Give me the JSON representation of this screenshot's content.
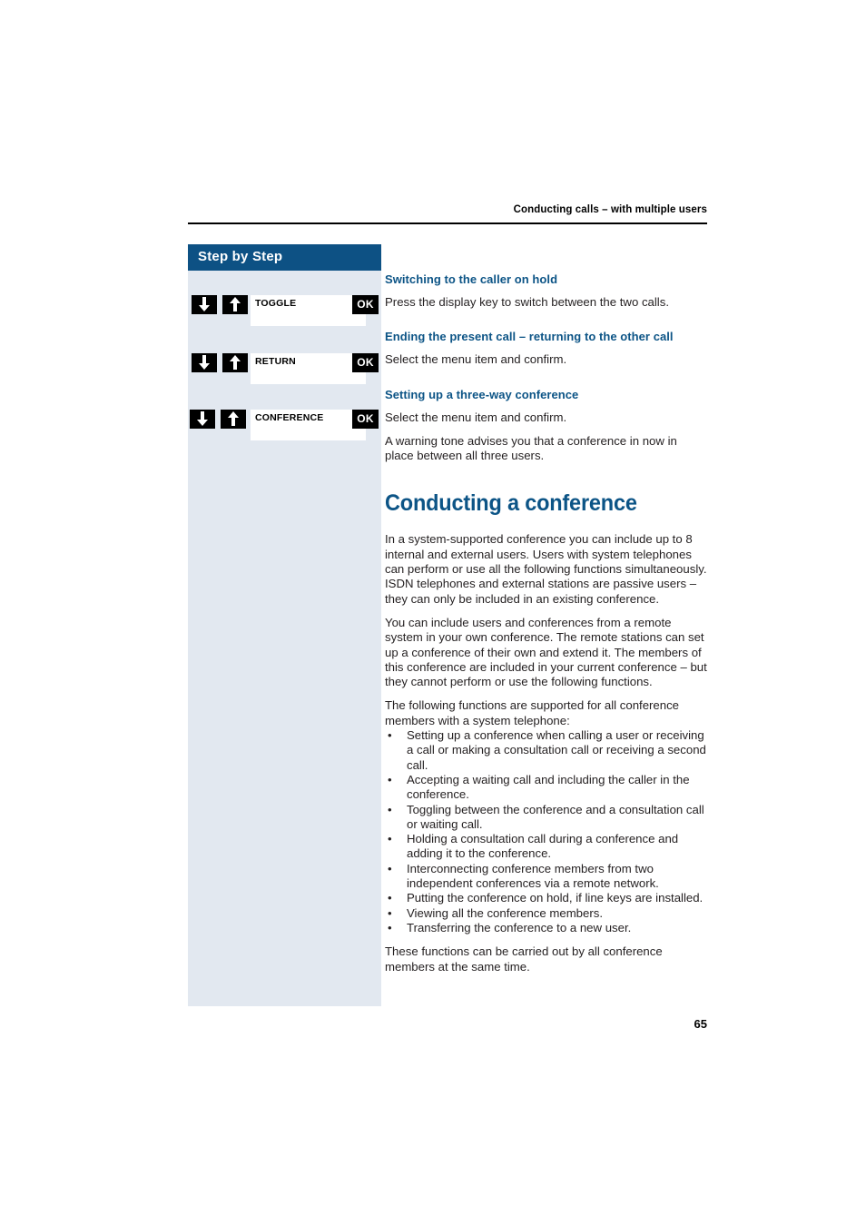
{
  "header": {
    "running_title": "Conducting calls – with multiple users"
  },
  "sidebar": {
    "title": "Step by Step",
    "key_rows": [
      {
        "down_icon": "arrow-down-icon",
        "up_icon": "arrow-up-icon",
        "display_label": "TOGGLE",
        "ok_label": "OK"
      },
      {
        "down_icon": "arrow-down-icon",
        "up_icon": "arrow-up-icon",
        "display_label": "RETURN",
        "ok_label": "OK"
      },
      {
        "down_icon": "arrow-down-icon",
        "up_icon": "arrow-up-icon",
        "display_label": "CONFERENCE",
        "ok_label": "OK"
      }
    ]
  },
  "content": {
    "section_1": {
      "heading": "Switching to the caller on hold",
      "text": "Press the display key to switch between the two calls."
    },
    "section_2": {
      "heading": "Ending the present call – returning to the other call",
      "text": "Select the menu item and confirm."
    },
    "section_3": {
      "heading": "Setting up a three-way conference",
      "text": "Select the menu item and confirm.",
      "text_2": "A warning tone advises you that a conference in now in place between all three users."
    },
    "chapter_title": "Conducting a conference",
    "paragraph_1": "In a system-supported conference you can include up to 8 internal and external users. Users with system telephones can perform or use all the following functions simultaneously. ISDN telephones and external stations are passive users – they can only be included in an existing conference.",
    "paragraph_2": "You can include users and conferences from a remote system in your own conference. The remote stations can set up a conference of their own and extend it. The members of this conference are included in your current conference – but they cannot perform or use the following functions.",
    "paragraph_3": "The following functions are supported for all conference members with a system telephone:",
    "bullets": [
      "Setting up a conference when calling a user or receiving a call or making a consultation call or receiving a second call.",
      "Accepting a waiting call and including the caller in the conference.",
      "Toggling between the conference and a consultation call or waiting call.",
      "Holding a consultation call during a conference and adding it to the conference.",
      "Interconnecting conference members from two independent conferences via a remote network.",
      "Putting the conference on hold, if line keys are installed.",
      "Viewing all the conference members.",
      "Transferring the conference to a new user."
    ],
    "bullet_glyph": "•",
    "paragraph_4": "These functions can be carried out by all conference members at the same time."
  },
  "footer": {
    "page_number": "65"
  },
  "colors": {
    "brand_blue": "#0d5184",
    "heading_blue": "#0c5486",
    "panel_bg": "#e2e8f0",
    "key_black": "#000000",
    "body_text": "#231f20"
  }
}
